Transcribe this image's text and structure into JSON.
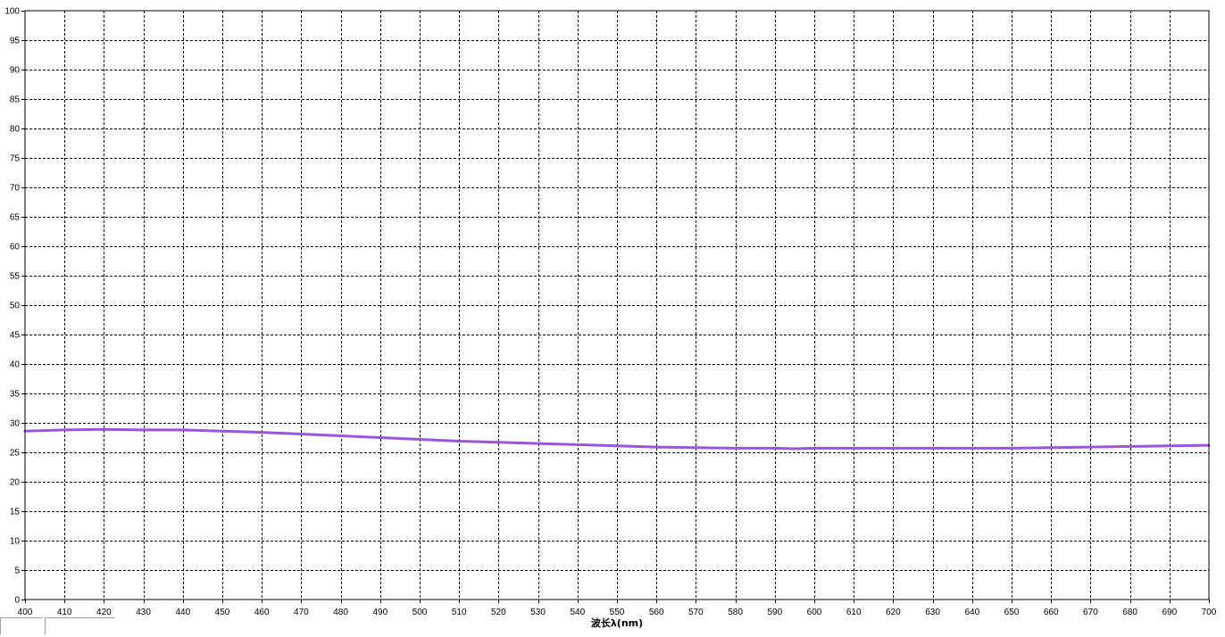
{
  "chart_data": {
    "type": "line",
    "title": "",
    "xlabel": "波长λ(nm)",
    "ylabel": "",
    "xlim": [
      400,
      700
    ],
    "ylim": [
      0,
      100
    ],
    "xticks": [
      400,
      410,
      420,
      430,
      440,
      450,
      460,
      470,
      480,
      490,
      500,
      510,
      520,
      530,
      540,
      550,
      560,
      570,
      580,
      590,
      600,
      610,
      620,
      630,
      640,
      650,
      660,
      670,
      680,
      690,
      700
    ],
    "yticks": [
      0,
      5,
      10,
      15,
      20,
      25,
      30,
      35,
      40,
      45,
      50,
      55,
      60,
      65,
      70,
      75,
      80,
      85,
      90,
      95,
      100
    ],
    "grid": true,
    "series": [
      {
        "name": "",
        "color": "#9955dd",
        "x": [
          400,
          410,
          420,
          430,
          440,
          450,
          460,
          470,
          480,
          490,
          500,
          510,
          520,
          530,
          540,
          550,
          560,
          570,
          580,
          590,
          595,
          600,
          610,
          620,
          630,
          640,
          650,
          660,
          670,
          680,
          690,
          700
        ],
        "y": [
          28.6,
          28.8,
          28.9,
          28.8,
          28.8,
          28.6,
          28.4,
          28.1,
          27.8,
          27.5,
          27.2,
          26.9,
          26.7,
          26.5,
          26.3,
          26.1,
          25.9,
          25.8,
          25.7,
          25.7,
          25.6,
          25.7,
          25.7,
          25.7,
          25.7,
          25.7,
          25.7,
          25.8,
          25.9,
          26.0,
          26.1,
          26.2
        ]
      }
    ]
  }
}
